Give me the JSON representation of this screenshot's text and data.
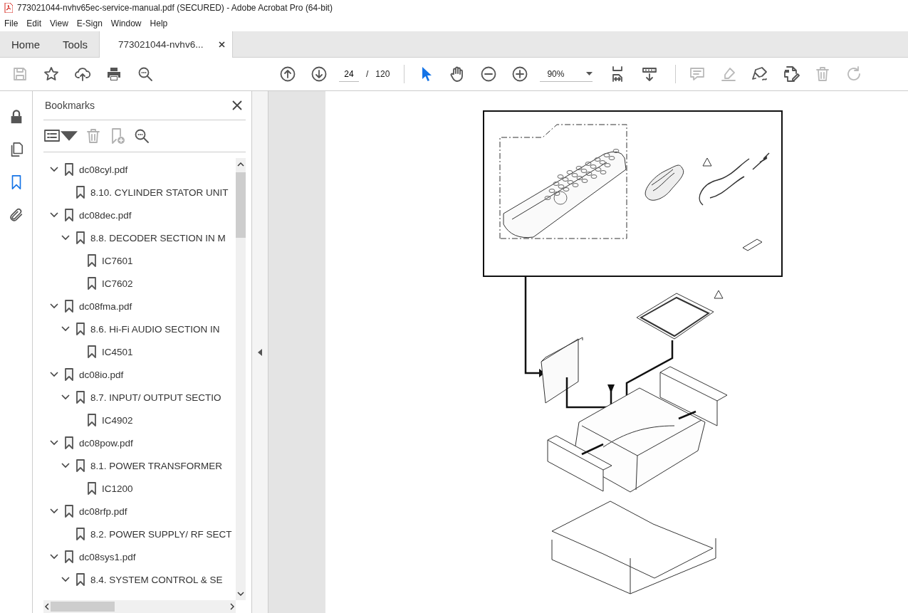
{
  "window": {
    "title": "773021044-nvhv65ec-service-manual.pdf (SECURED) - Adobe Acrobat Pro (64-bit)"
  },
  "menu": [
    "File",
    "Edit",
    "View",
    "E-Sign",
    "Window",
    "Help"
  ],
  "tabs": [
    {
      "label": "Home",
      "selected": false,
      "kind": "nav"
    },
    {
      "label": "Tools",
      "selected": false,
      "kind": "nav"
    },
    {
      "label": "773021044-nvhv6...",
      "selected": true,
      "kind": "document"
    }
  ],
  "toolbar": {
    "left_tools": [
      {
        "kind": "save",
        "disabled": true
      },
      {
        "kind": "star",
        "disabled": false
      },
      {
        "kind": "upload",
        "disabled": false
      },
      {
        "kind": "print",
        "disabled": false
      },
      {
        "kind": "find",
        "disabled": false
      }
    ],
    "page_current": "24",
    "page_separator": "/",
    "page_total": "120",
    "nav_tools": [
      {
        "kind": "pointer",
        "selected": true
      },
      {
        "kind": "hand",
        "selected": false
      }
    ],
    "zoom": "90%",
    "right_tools": [
      {
        "kind": "comment",
        "disabled": true
      },
      {
        "kind": "highlight",
        "disabled": true
      },
      {
        "kind": "sign",
        "disabled": false
      },
      {
        "kind": "edit",
        "disabled": false
      },
      {
        "kind": "delete",
        "disabled": true
      },
      {
        "kind": "rotate",
        "disabled": true
      }
    ]
  },
  "side_rail": [
    {
      "kind": "lock",
      "selected": false
    },
    {
      "kind": "pages",
      "selected": false
    },
    {
      "kind": "bookmark",
      "selected": true
    },
    {
      "kind": "attachment",
      "selected": false
    }
  ],
  "bookmarks": {
    "title": "Bookmarks",
    "tools": [
      {
        "kind": "options",
        "disabled": false
      },
      {
        "kind": "delete",
        "disabled": true
      },
      {
        "kind": "add",
        "disabled": true
      },
      {
        "kind": "find",
        "disabled": false
      }
    ],
    "items": [
      {
        "label": "dc08cyl.pdf",
        "expanded": true,
        "children": [
          {
            "label": "8.10. CYLINDER STATOR UNIT"
          }
        ]
      },
      {
        "label": "dc08dec.pdf",
        "expanded": true,
        "children": [
          {
            "label": "8.8. DECODER SECTION IN M",
            "expanded": true,
            "children": [
              {
                "label": "IC7601"
              },
              {
                "label": "IC7602"
              }
            ]
          }
        ]
      },
      {
        "label": "dc08fma.pdf",
        "expanded": true,
        "children": [
          {
            "label": "8.6. Hi-Fi AUDIO SECTION IN",
            "expanded": true,
            "children": [
              {
                "label": "IC4501"
              }
            ]
          }
        ]
      },
      {
        "label": "dc08io.pdf",
        "expanded": true,
        "children": [
          {
            "label": "8.7. INPUT/ OUTPUT SECTIO",
            "expanded": true,
            "children": [
              {
                "label": "IC4902"
              }
            ]
          }
        ]
      },
      {
        "label": "dc08pow.pdf",
        "expanded": true,
        "children": [
          {
            "label": "8.1. POWER TRANSFORMER",
            "expanded": true,
            "children": [
              {
                "label": "IC1200"
              }
            ]
          }
        ]
      },
      {
        "label": "dc08rfp.pdf",
        "expanded": true,
        "children": [
          {
            "label": "8.2. POWER SUPPLY/ RF SECT"
          }
        ]
      },
      {
        "label": "dc08sys1.pdf",
        "expanded": true,
        "children": [
          {
            "label": "8.4. SYSTEM CONTROL & SE",
            "expanded": true
          }
        ]
      }
    ]
  },
  "document": {
    "kind": "picture"
  }
}
